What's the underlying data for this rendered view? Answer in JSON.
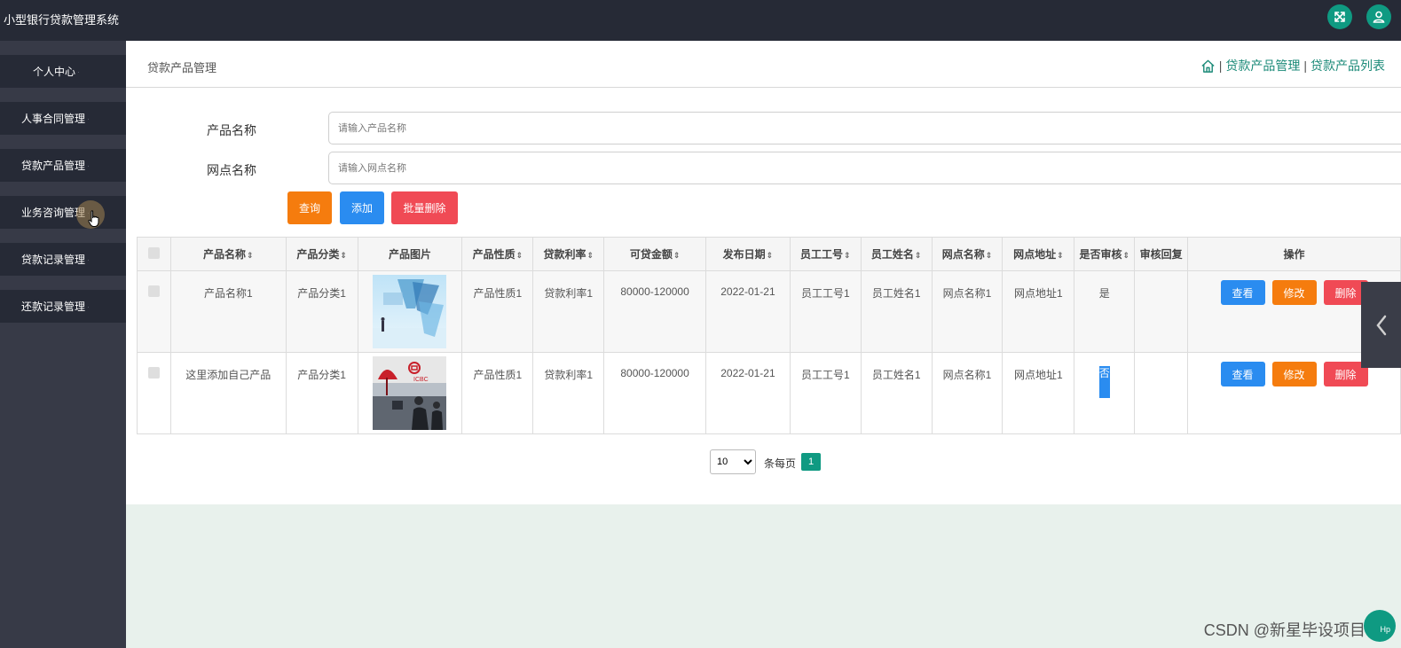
{
  "app": {
    "title": "小型银行贷款管理系统"
  },
  "topbar": {
    "fullscreen_icon": "expand-icon",
    "user_icon": "user-icon"
  },
  "sidebar": {
    "items": [
      {
        "label": "个人中心"
      },
      {
        "label": "人事合同管理"
      },
      {
        "label": "贷款产品管理"
      },
      {
        "label": "业务咨询管理"
      },
      {
        "label": "贷款记录管理"
      },
      {
        "label": "还款记录管理"
      }
    ]
  },
  "page": {
    "title": "贷款产品管理",
    "breadcrumb": {
      "home_icon": "home-icon",
      "sep": "|",
      "level1": "贷款产品管理",
      "level2": "贷款产品列表"
    }
  },
  "search": {
    "name_label": "产品名称",
    "name_placeholder": "请输入产品名称",
    "branch_label": "网点名称",
    "branch_placeholder": "请输入网点名称",
    "query_label": "查询",
    "add_label": "添加",
    "batch_delete_label": "批量删除"
  },
  "table": {
    "columns": [
      "产品名称",
      "产品分类",
      "产品图片",
      "产品性质",
      "贷款利率",
      "可贷金额",
      "发布日期",
      "员工工号",
      "员工姓名",
      "网点名称",
      "网点地址",
      "是否审核",
      "审核回复",
      "操作"
    ],
    "sort_icon": "sort-icon",
    "rows": [
      {
        "name": "产品名称1",
        "category": "产品分类1",
        "image": "business-photo",
        "nature": "产品性质1",
        "rate": "贷款利率1",
        "amount": "80000-120000",
        "date": "2022-01-21",
        "staff_no": "员工工号1",
        "staff_name": "员工姓名1",
        "branch": "网点名称1",
        "address": "网点地址1",
        "audited": "是",
        "reply": ""
      },
      {
        "name": "这里添加自己产品",
        "category": "产品分类1",
        "image": "bank-office-photo",
        "nature": "产品性质1",
        "rate": "贷款利率1",
        "amount": "80000-120000",
        "date": "2022-01-21",
        "staff_no": "员工工号1",
        "staff_name": "员工姓名1",
        "branch": "网点名称1",
        "address": "网点地址1",
        "audited": "否",
        "reply": ""
      }
    ],
    "actions": {
      "view": "查看",
      "edit": "修改",
      "delete": "删除"
    }
  },
  "pagination": {
    "page_size": "10",
    "page_size_options": [
      "10"
    ],
    "per_page_label": "条每页",
    "current_page": "1"
  },
  "watermark": {
    "text": "CSDN @新星毕设项目"
  },
  "help": {
    "label": "Hp"
  },
  "colors": {
    "sidebar": "#373a47",
    "topbar": "#262a36",
    "accent": "#0f9a82",
    "orange": "#f57c0e",
    "blue": "#2a8cf0",
    "red": "#f04a55"
  }
}
